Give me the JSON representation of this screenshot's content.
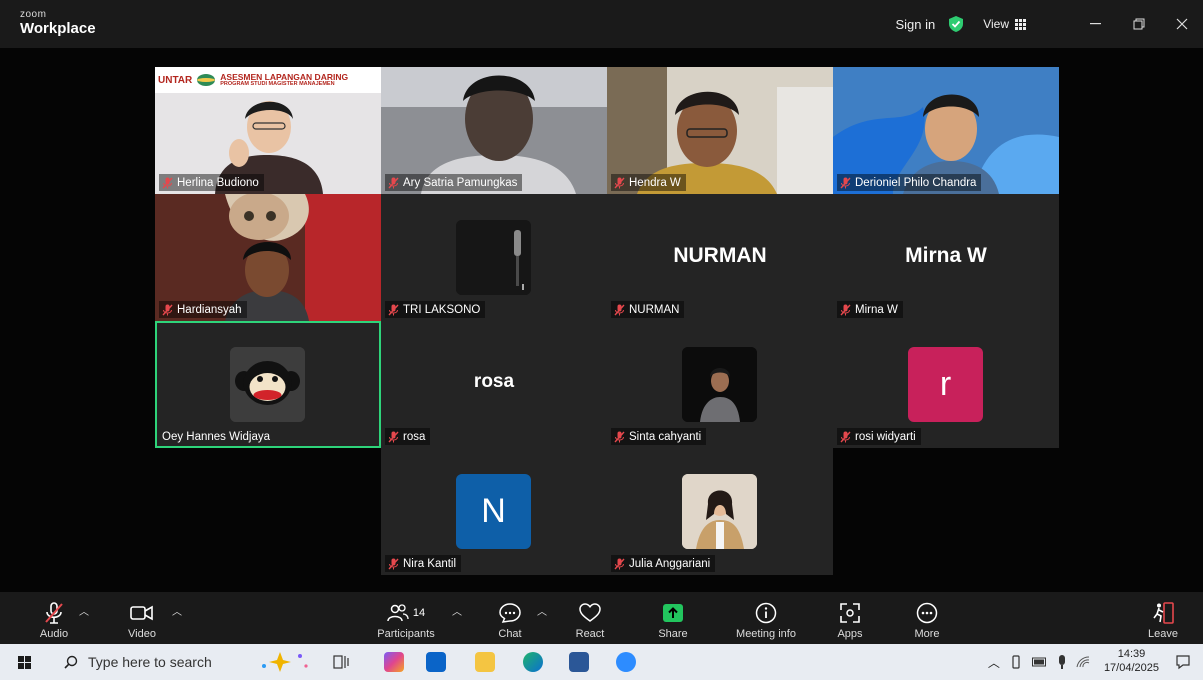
{
  "app": {
    "brand_small": "zoom",
    "brand_name": "Workplace"
  },
  "titlebar": {
    "signin": "Sign in",
    "view": "View"
  },
  "colors": {
    "active_border": "#2ed47a",
    "mic_off": "#e5484d",
    "toolbar_bg": "#1a1a1a",
    "tile_bg": "#242424",
    "share_green": "#22c55e",
    "avatar_n": "#0e5fa8",
    "avatar_r": "#c8215b"
  },
  "participants_count": "14",
  "tiles": [
    {
      "name": "Herlina Budiono",
      "type": "video",
      "banner": {
        "org": "UNTAR",
        "title": "ASESMEN LAPANGAN DARING",
        "subtitle": "PROGRAM STUDI MAGISTER MANAJEMEN"
      }
    },
    {
      "name": "Ary Satria Pamungkas",
      "type": "video"
    },
    {
      "name": "Hendra W",
      "type": "video"
    },
    {
      "name": "Derioniel Philo Chandra",
      "type": "video"
    },
    {
      "name": "Hardiansyah",
      "type": "video"
    },
    {
      "name": "TRI LAKSONO",
      "type": "photo"
    },
    {
      "name": "NURMAN",
      "type": "text",
      "display": "NURMAN"
    },
    {
      "name": "Mirna W",
      "type": "text",
      "display": "Mirna W"
    },
    {
      "name": "Oey Hannes Widjaya",
      "type": "photo",
      "active": true
    },
    {
      "name": "rosa",
      "type": "text",
      "display": "rosa"
    },
    {
      "name": "Sinta cahyanti",
      "type": "photo"
    },
    {
      "name": "rosi widyarti",
      "type": "letter",
      "display": "r"
    },
    {
      "name": "Nira Kantil",
      "type": "letter",
      "display": "N"
    },
    {
      "name": "Julia Anggariani",
      "type": "photo"
    }
  ],
  "toolbar": {
    "audio": "Audio",
    "video": "Video",
    "participants": "Participants",
    "chat": "Chat",
    "react": "React",
    "share": "Share",
    "meeting_info": "Meeting info",
    "apps": "Apps",
    "more": "More",
    "leave": "Leave"
  },
  "taskbar": {
    "search_placeholder": "Type here to search",
    "time": "14:39",
    "date": "17/04/2025"
  }
}
